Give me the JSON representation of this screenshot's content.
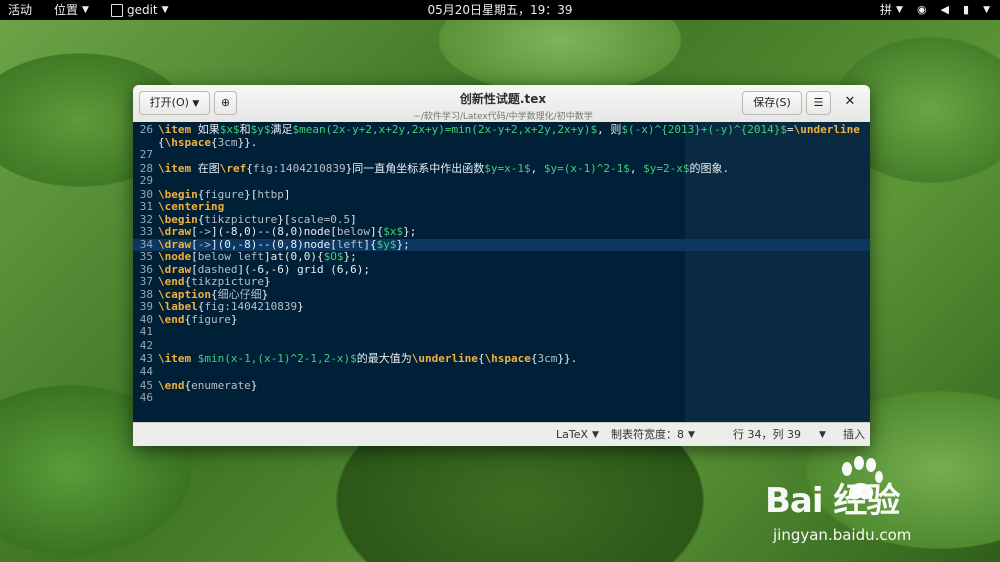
{
  "topbar": {
    "activities": "活动",
    "places": "位置",
    "app": "gedit",
    "clock": "05月20日星期五，19：39",
    "input_method": "拼"
  },
  "window": {
    "title": "创新性试题.tex",
    "path": "~/软件学习/Latex代码/中学数理化/初中数学",
    "open_label": "打开(O)",
    "save_label": "保存(S)"
  },
  "editor": {
    "current_line": 34,
    "lines": [
      {
        "num": "26",
        "text": "\\item 如果$x$和$y$满足$mean(2x-y+2,x+2y,2x+y)=min(2x-y+2,x+2y,2x+y)$, 则$(-x)^{2013}+(-y)^{2014}$=\\underline"
      },
      {
        "num": "",
        "text": "{\\hspace{3cm}}."
      },
      {
        "num": "27",
        "text": ""
      },
      {
        "num": "28",
        "text": "\\item 在图\\ref{fig:1404210839}同一直角坐标系中作出函数$y=x-1$, $y=(x-1)^2-1$, $y=2-x$的图象."
      },
      {
        "num": "29",
        "text": ""
      },
      {
        "num": "30",
        "text": "\\begin{figure}[htbp]"
      },
      {
        "num": "31",
        "text": "\\centering"
      },
      {
        "num": "32",
        "text": "\\begin{tikzpicture}[scale=0.5]"
      },
      {
        "num": "33",
        "text": "\\draw[->](-8,0)--(8,0)node[below]{$x$};"
      },
      {
        "num": "34",
        "text": "\\draw[->](0,-8)--(0,8)node[left]{$y$};"
      },
      {
        "num": "35",
        "text": "\\node[below left]at(0,0){$O$};"
      },
      {
        "num": "36",
        "text": "\\draw[dashed](-6,-6) grid (6,6);"
      },
      {
        "num": "37",
        "text": "\\end{tikzpicture}"
      },
      {
        "num": "38",
        "text": "\\caption{细心仔细}"
      },
      {
        "num": "39",
        "text": "\\label{fig:1404210839}"
      },
      {
        "num": "40",
        "text": "\\end{figure}"
      },
      {
        "num": "41",
        "text": ""
      },
      {
        "num": "42",
        "text": ""
      },
      {
        "num": "43",
        "text": "\\item $min(x-1,(x-1)^2-1,2-x)$的最大值为\\underline{\\hspace{3cm}}."
      },
      {
        "num": "44",
        "text": ""
      },
      {
        "num": "45",
        "text": "\\end{enumerate}"
      },
      {
        "num": "46",
        "text": ""
      }
    ]
  },
  "statusbar": {
    "language": "LaTeX",
    "tab_width": "制表符宽度：8",
    "position": "行 34，列 39",
    "insert_mode": "插入"
  },
  "watermark": {
    "logo": "Bai 经验",
    "url": "jingyan.baidu.com"
  }
}
